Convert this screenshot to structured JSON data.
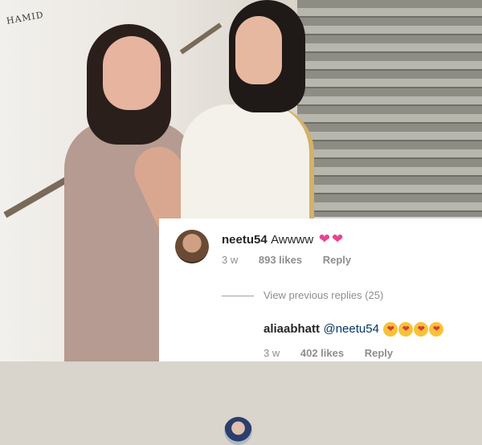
{
  "background": {
    "wall_sign": "HAMID"
  },
  "comments": [
    {
      "username": "neetu54",
      "text": "Awwww",
      "emojis": [
        "heart-icon",
        "heart-icon"
      ],
      "time": "3 w",
      "likes": "893 likes",
      "reply": "Reply"
    },
    {
      "username": "aliaabhatt",
      "mention": "@neetu54",
      "emojis": [
        "kiss-face-icon",
        "kiss-face-icon",
        "kiss-face-icon",
        "kiss-face-icon"
      ],
      "time": "3 w",
      "likes": "402 likes",
      "reply": "Reply"
    }
  ],
  "view_replies": "View previous replies (25)",
  "colors": {
    "accent_heart": "#e84393",
    "mention": "#003569",
    "muted": "#8e8e8e"
  }
}
